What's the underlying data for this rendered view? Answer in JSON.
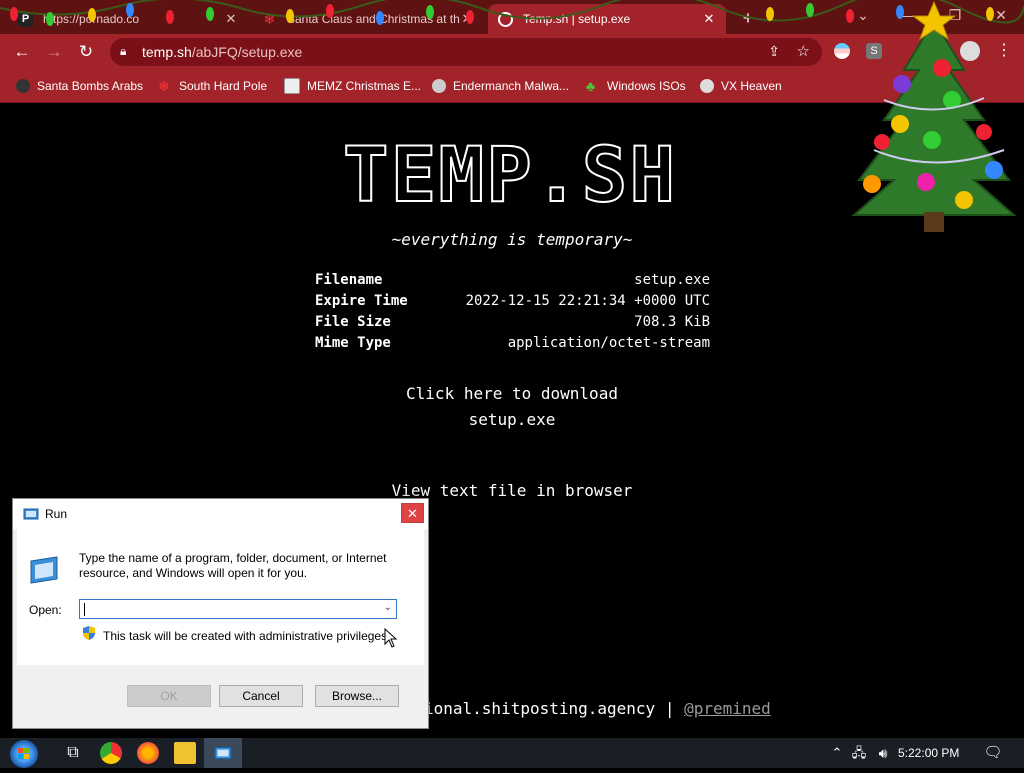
{
  "browser": {
    "tabs": [
      {
        "title": "https://pornado.co",
        "active": false
      },
      {
        "title": "Santa Claus and Christmas at the",
        "active": false
      },
      {
        "title": "Temp.sh | setup.exe",
        "active": true
      }
    ],
    "address": {
      "domain": "temp.sh",
      "path": "/abJFQ/setup.exe"
    },
    "bookmarks": [
      {
        "label": "Santa Bombs Arabs",
        "icon": "bomb-icon"
      },
      {
        "label": "South Hard Pole",
        "icon": "snowflake-icon"
      },
      {
        "label": "MEMZ Christmas E...",
        "icon": "memz-icon"
      },
      {
        "label": "Endermanch Malwa...",
        "icon": "skull-icon"
      },
      {
        "label": "Windows ISOs",
        "icon": "tree-icon"
      },
      {
        "label": "VX Heaven",
        "icon": "vx-icon"
      }
    ],
    "theme_color": "#a3232b"
  },
  "page": {
    "logo": "TEMP.SH",
    "tagline": "~everything is temporary~",
    "info": [
      {
        "key": "Filename",
        "value": "setup.exe"
      },
      {
        "key": "Expire Time",
        "value": "2022-12-15 22:21:34 +0000 UTC"
      },
      {
        "key": "File Size",
        "value": "708.3 KiB"
      },
      {
        "key": "Mime Type",
        "value": "application/octet-stream"
      }
    ],
    "download_line1": "Click here to download",
    "download_line2": "setup.exe",
    "view_text": "View text file in browser",
    "footer_text": "ional.shitposting.agency | ",
    "footer_link": "@premined"
  },
  "run_dialog": {
    "title": "Run",
    "description": "Type the name of a program, folder, document, or Internet resource, and Windows will open it for you.",
    "open_label": "Open:",
    "open_value": "",
    "admin_note": "This task will be created with administrative privileges.",
    "ok": "OK",
    "cancel": "Cancel",
    "browse": "Browse..."
  },
  "taskbar": {
    "clock": "5:22:00 PM"
  }
}
